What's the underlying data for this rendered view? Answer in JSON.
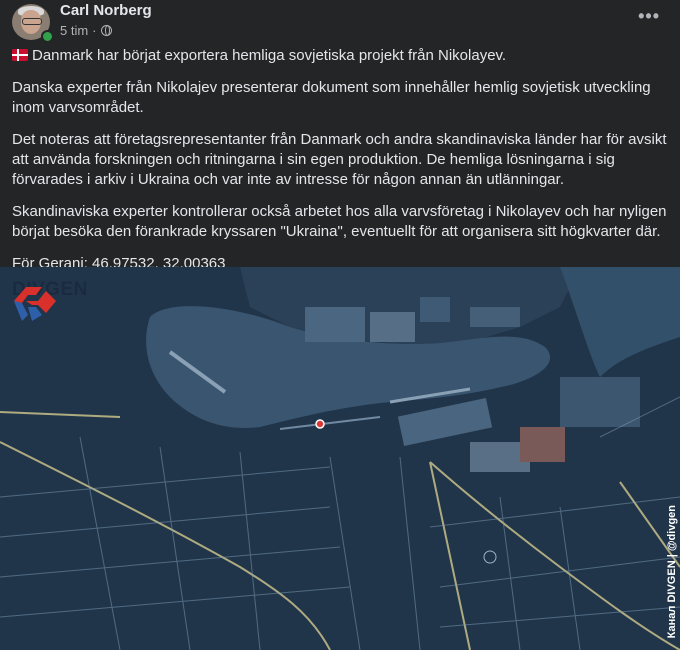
{
  "post": {
    "author": "Carl Norberg",
    "time": "5 tim",
    "separator": "·",
    "more_icon": "ellipsis-icon",
    "audience_icon": "globe-icon"
  },
  "content": {
    "line1": "Danmark har börjat exportera hemliga sovjetiska projekt från Nikolayev.",
    "line1_icon": "denmark-flag-icon",
    "p2": "Danska experter från Nikolajev presenterar dokument som innehåller hemlig sovjetisk utveckling inom varvsområdet.",
    "p3": "Det noteras att företagsrepresentanter från Danmark och andra skandinaviska länder har för avsikt att använda forskningen och ritningarna i sin egen produktion. De hemliga lösningarna i sig förvarades i arkiv i Ukraina och var inte av intresse för någon annan än utlänningar.",
    "p4": "Skandinaviska experter kontrollerar också arbetet hos alla varvsföretag i Nikolayev och har nyligen börjat besöka den förankrade kryssaren \"Ukraina\", eventuellt för att organisera sitt högkvarter där.",
    "p5": "För Gerani: 46.97532, 32.00363"
  },
  "image": {
    "logo_text": "DIVGEN",
    "credit": "Канал DIVGEN | @divgen",
    "colors": {
      "water": "#3a5570",
      "land": "#23364a",
      "road": "#c8c08a",
      "logo_red": "#d9302c",
      "logo_blue": "#2f5fa8"
    }
  }
}
